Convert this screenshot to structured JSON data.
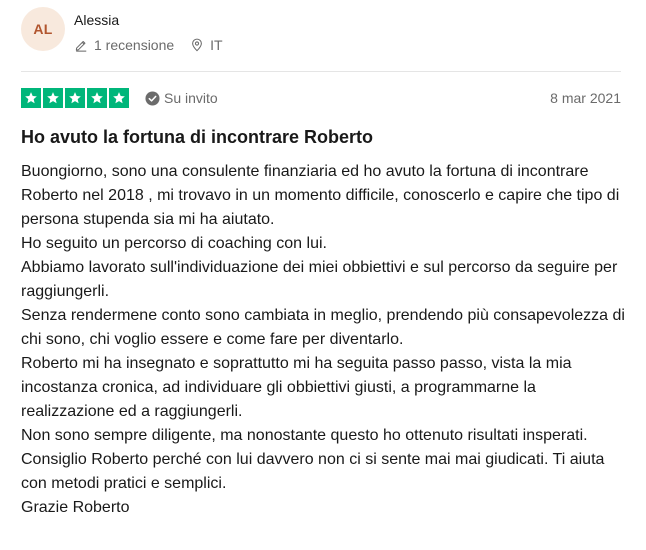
{
  "reviewer": {
    "initials": "AL",
    "name": "Alessia",
    "reviews_count_label": "1 recensione",
    "country": "IT"
  },
  "review": {
    "rating": 5,
    "rating_max": 5,
    "invited_label": "Su invito",
    "date": "8 mar 2021",
    "title": "Ho avuto la fortuna di incontrare Roberto",
    "body": [
      "Buongiorno, sono una consulente finanziaria ed ho avuto la fortuna di incontrare Roberto nel 2018 , mi trovavo in un momento difficile, conoscerlo e capire che tipo di persona stupenda sia mi ha aiutato.",
      "Ho seguito un percorso di coaching con lui.",
      "Abbiamo lavorato sull'individuazione dei miei obbiettivi e sul percorso da seguire per raggiungerli.",
      "Senza rendermene conto sono cambiata in meglio, prendendo più consapevolezza di chi sono, chi voglio essere e come fare per diventarlo.",
      "Roberto mi ha insegnato e soprattutto mi ha seguita passo passo, vista la mia incostanza cronica, ad individuare gli obbiettivi giusti, a programmarne la realizzazione ed a raggiungerli.",
      "Non sono sempre diligente, ma nonostante questo ho ottenuto risultati insperati.",
      "Consiglio Roberto perché con lui davvero non ci si sente mai mai giudicati. Ti aiuta con metodi pratici e semplici.",
      "Grazie Roberto"
    ]
  },
  "icons": {
    "reviews": "pencil-icon",
    "country": "location-pin-icon",
    "invited": "check-circle-icon",
    "star": "star-icon"
  },
  "colors": {
    "star_green": "#00b67a",
    "avatar_bg": "#f8e9dd",
    "avatar_text": "#b1552e",
    "muted_text": "#6b6b6b"
  }
}
